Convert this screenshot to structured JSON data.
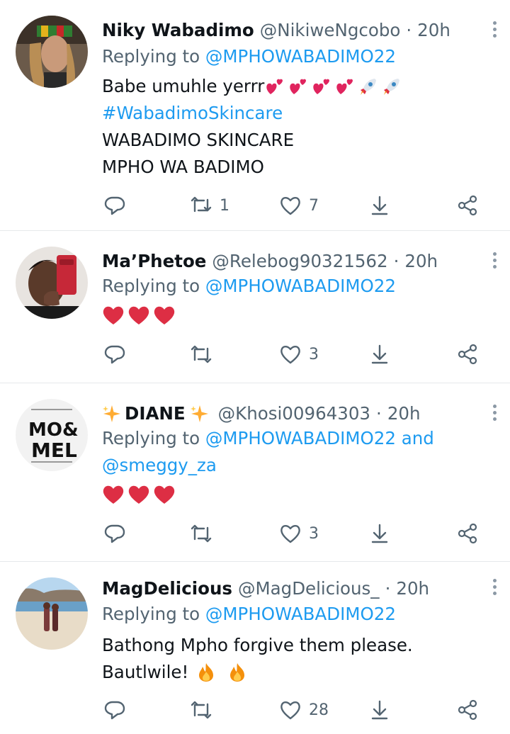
{
  "tweets": [
    {
      "name": "Niky Wabadimo",
      "handle": "@NikiweNgcobo",
      "time": "20h",
      "replying_prefix": "Replying to",
      "replying_to": "@MPHOWABADIMO22",
      "replying_and": "",
      "replying_to2": "",
      "text_line1": "Babe umuhle yerrr",
      "hashtag": "#WabadimoSkincare",
      "text_line3": "WABADIMO SKINCARE",
      "text_line4": "MPHO WA BADIMO",
      "emoji": [
        "two-hearts",
        "two-hearts",
        "two-hearts",
        "two-hearts",
        "rocket",
        "rocket"
      ],
      "retweets": "1",
      "likes": "7"
    },
    {
      "name": "Ma’Phetoe",
      "handle": "@Relebog90321562",
      "time": "20h",
      "replying_prefix": "Replying to",
      "replying_to": "@MPHOWABADIMO22",
      "emoji": [
        "red-heart",
        "red-heart",
        "red-heart"
      ],
      "retweets": "",
      "likes": "3"
    },
    {
      "name_prefix_emoji": "sparkles",
      "name": "DIANE",
      "name_suffix_emoji": "sparkles",
      "handle": "@Khosi00964303",
      "time": "20h",
      "replying_prefix": "Replying to",
      "replying_to": "@MPHOWABADIMO22",
      "replying_and": "and",
      "replying_to2": "@smeggy_za",
      "avatar_text_top": "MO&",
      "avatar_text_bottom": "MEL",
      "emoji": [
        "red-heart",
        "red-heart",
        "red-heart"
      ],
      "retweets": "",
      "likes": "3"
    },
    {
      "name": "MagDelicious",
      "handle": "@MagDelicious_",
      "time": "20h",
      "replying_prefix": "Replying to",
      "replying_to": "@MPHOWABADIMO22",
      "text_line1": "Bathong Mpho forgive them please.",
      "text_line2": "Bautlwile!",
      "emoji": [
        "fire",
        "fire"
      ],
      "retweets": "",
      "likes": "28"
    }
  ],
  "separator_dot": "·",
  "colors": {
    "link": "#1d9bf0",
    "muted": "#536471",
    "heart": "#e0245e"
  }
}
